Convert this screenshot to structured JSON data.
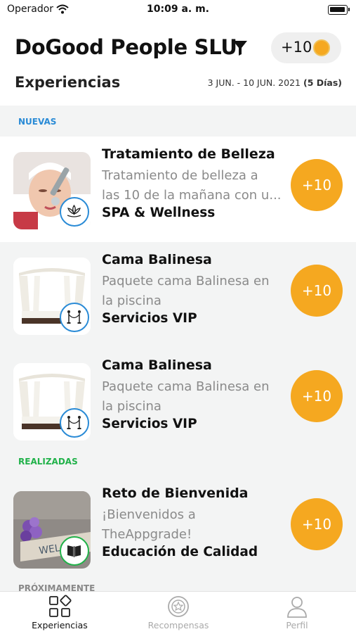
{
  "status_bar": {
    "carrier": "Operador",
    "time": "10:09 a. m."
  },
  "header": {
    "company": "DoGood People SLU",
    "points": "+10",
    "section": "Experiencias",
    "date_range": "3 JUN. - 10 JUN. 2021",
    "days": "(5 Días)"
  },
  "sections": {
    "new": "NUEVAS",
    "done": "REALIZADAS",
    "upcoming": "PRÓXIMAMENTE"
  },
  "cards": [
    {
      "title": "Tratamiento de Belleza",
      "desc_line1": "Tratamiento de belleza a",
      "desc_line2": "las 10 de la mañana con u...",
      "category": "SPA & Wellness",
      "reward": "+10",
      "badge_icon": "lotus-icon"
    },
    {
      "title": "Cama Balinesa",
      "desc_line1": "Paquete cama Balinesa en",
      "desc_line2": "la piscina",
      "category": "Servicios VIP",
      "reward": "+10",
      "badge_icon": "vip-rope-icon"
    },
    {
      "title": "Cama Balinesa",
      "desc_line1": "Paquete cama Balinesa en",
      "desc_line2": "la piscina",
      "category": "Servicios VIP",
      "reward": "+10",
      "badge_icon": "vip-rope-icon"
    },
    {
      "title": "Reto de Bienvenida",
      "desc_line1": "¡Bienvenidos a",
      "desc_line2": "TheAppgrade!",
      "category": "Educación de Calidad",
      "reward": "+10",
      "badge_icon": "book-icon",
      "image_sign_text": "WELCO"
    }
  ],
  "tabs": [
    {
      "label": "Experiencias",
      "icon": "experiences-grid-icon",
      "active": true
    },
    {
      "label": "Recompensas",
      "icon": "rewards-coin-icon",
      "active": false
    },
    {
      "label": "Perfil",
      "icon": "profile-icon",
      "active": false
    }
  ],
  "colors": {
    "accent_orange": "#f5a820",
    "blue": "#2a8bd6",
    "green": "#21b24a",
    "band_gray": "#f3f4f4"
  }
}
